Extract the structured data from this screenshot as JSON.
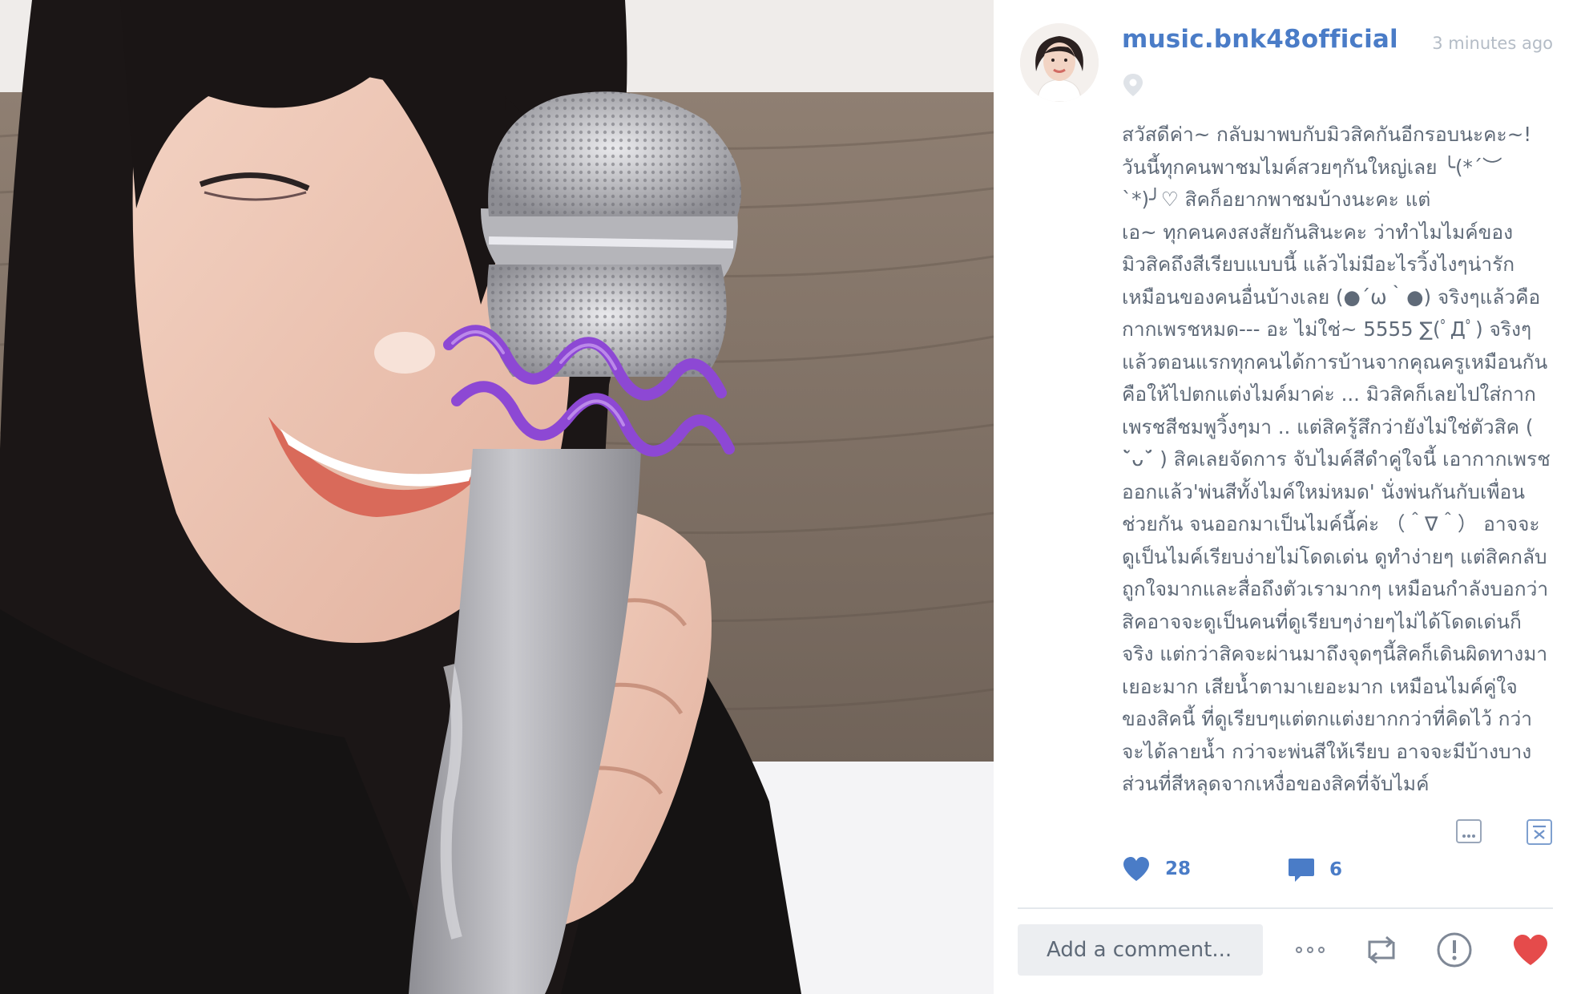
{
  "post": {
    "username": "music.bnk48official",
    "timestamp": "3 minutes ago",
    "caption_part1": "สวัสดีค่า~ กลับมาพบกับมิวสิคกันอีกรอบนะคะ~! วันนี้ทุกคนพาชมไมค์สวยๆกันใหญ่เลย ╰(*´︶`*)╯♡ สิคก็อยากพาชมบ้างนะคะ แต่",
    "caption_part2": "เอ~ ทุกคนคงสงสัยกันสินะคะ ว่าทำไมไมค์ของมิวสิคถึงสีเรียบแบบนี้ แล้วไม่มีอะไรวิ้งไงๆน่ารักเหมือนของคนอื่นบ้างเลย (●´ω｀●) จริงๆแล้วคือกากเพรชหมด--- อะ ไม่ใช่~ 5555 ∑(ﾟДﾟ) จริงๆแล้วตอนแรกทุกคนได้การบ้านจากคุณครูเหมือนกัน คือให้ไปตกแต่งไมค์มาค่ะ ... มิวสิคก็เลยไปใส่กากเพรชสีชมพูวิ้งๆมา .. แต่สิครู้สึกว่ายังไม่ใช่ตัวสิค ( ˘̀ᴗ˘́ ) สิคเลยจัดการ จับไมค์สีดำคู่ใจนี้ เอากากเพรชออกแล้ว'พ่นสีทั้งไมค์ใหม่หมด' นั่งพ่นกันกับเพื่อนช่วยกัน จนออกมาเป็นไมค์นี้ค่ะ （＾∇＾） อาจจะดูเป็นไมค์เรียบง่ายไม่โดดเด่น ดูทำง่ายๆ แต่สิคกลับถูกใจมากและสื่อถึงตัวเรามากๆ เหมือนกำลังบอกว่า สิคอาจจะดูเป็นคนที่ดูเรียบๆง่ายๆไม่ได้โดดเด่นก็จริง แต่กว่าสิคจะผ่านมาถึงจุดๆนี้สิคก็เดินผิดทางมาเยอะมาก เสียน้ำตามาเยอะมาก เหมือนไมค์คู่ใจของสิคนี้ ที่ดูเรียบๆแต่ตกแต่งยากกว่าที่คิดไว้ กว่าจะได้ลายน้ำ กว่าจะพ่นสีให้เรียบ อาจจะมีบ้างบางส่วนที่สีหลุดจากเหงื่อของสิคที่จับไมค์",
    "likes": "28",
    "comments": "6"
  },
  "comment_box": {
    "placeholder": "Add a comment..."
  },
  "icons": {
    "location": "location-pin-icon",
    "like": "heart-icon",
    "comment": "speech-bubble-icon",
    "more": "more-dots-icon",
    "repost": "repost-icon",
    "report": "report-icon",
    "favorite": "favorite-heart-icon",
    "expand": "collapse-icon"
  },
  "colors": {
    "accent": "#4a7cc7",
    "text": "#5f6a78",
    "muted": "#b4bcc6",
    "heart": "#e54b4b"
  }
}
